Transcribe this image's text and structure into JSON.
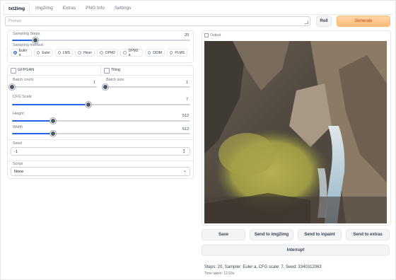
{
  "tabs": [
    {
      "label": "txt2img",
      "active": true
    },
    {
      "label": "img2img"
    },
    {
      "label": "Extras"
    },
    {
      "label": "PNG Info"
    },
    {
      "label": "Settings"
    }
  ],
  "prompt": {
    "placeholder": "Prompt",
    "value": ""
  },
  "buttons": {
    "roll": "Roll",
    "generate": "Generate"
  },
  "settings": {
    "sampling_steps": {
      "label": "Sampling Steps",
      "value": "20",
      "fraction": 0.13
    },
    "sampling_method": {
      "label": "Sampling method",
      "options": [
        "Euler a",
        "Euler",
        "LMS",
        "Heun",
        "DPM2",
        "DPM2 a",
        "DDIM",
        "PLMS"
      ],
      "selected": "Euler a"
    },
    "gfpgan": {
      "label": "GFPGAN",
      "checked": false
    },
    "tiling": {
      "label": "Tiling",
      "checked": false
    },
    "batch_count": {
      "label": "Batch count",
      "value": "1",
      "fraction": 0.0
    },
    "batch_size": {
      "label": "Batch size",
      "value": "1",
      "fraction": 0.0
    },
    "cfg_scale": {
      "label": "CFG Scale",
      "value": "7",
      "fraction": 0.43
    },
    "height": {
      "label": "Height",
      "value": "512",
      "fraction": 0.23
    },
    "width": {
      "label": "Width",
      "value": "512",
      "fraction": 0.23
    },
    "seed": {
      "label": "Seed",
      "value": "-1"
    },
    "script": {
      "label": "Script",
      "value": "None"
    }
  },
  "output": {
    "label": "Output",
    "actions": {
      "save": "Save",
      "send_img2img": "Send to img2img",
      "send_inpaint": "Send to inpaint",
      "send_extras": "Send to extras",
      "interrupt": "Interrupt"
    },
    "info": "Steps: 20, Sampler: Euler a, CFG scale: 7, Seed: 3340312063",
    "time": "Time taken: 12.63s"
  },
  "colors": {
    "accent": "#2563eb",
    "generate": "#fdba74"
  }
}
